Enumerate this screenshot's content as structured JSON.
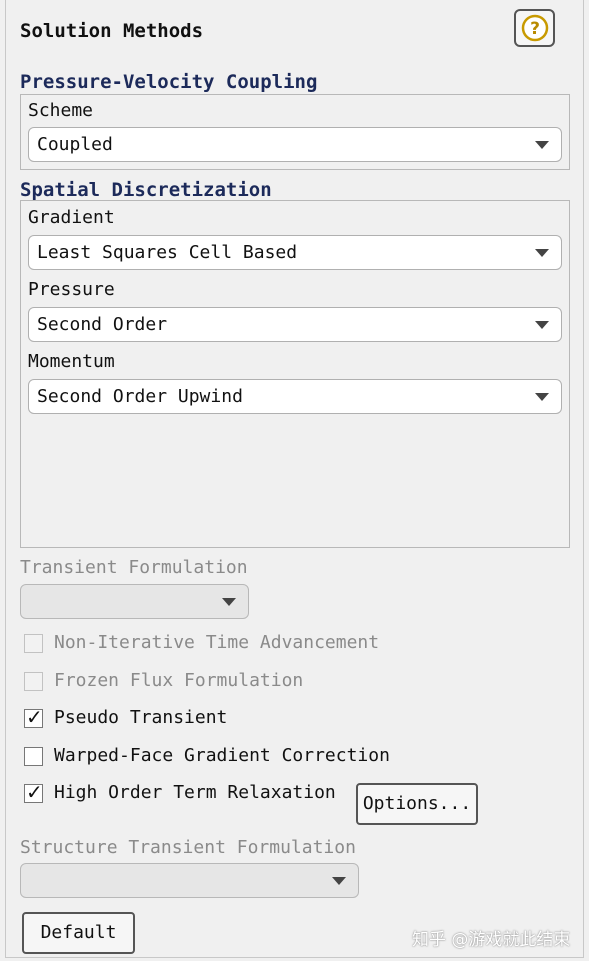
{
  "panel": {
    "title": "Solution Methods"
  },
  "help": {
    "icon": "help-icon",
    "glyph": "?"
  },
  "pressure_velocity": {
    "title": "Pressure-Velocity Coupling",
    "scheme_label": "Scheme",
    "scheme_value": "Coupled"
  },
  "spatial": {
    "title": "Spatial Discretization",
    "gradient_label": "Gradient",
    "gradient_value": "Least Squares Cell Based",
    "pressure_label": "Pressure",
    "pressure_value": "Second Order",
    "momentum_label": "Momentum",
    "momentum_value": "Second Order Upwind"
  },
  "transient": {
    "label": "Transient Formulation",
    "value": ""
  },
  "options": {
    "non_iterative": {
      "label": "Non-Iterative Time Advancement",
      "checked": false,
      "enabled": false
    },
    "frozen_flux": {
      "label": "Frozen Flux Formulation",
      "checked": false,
      "enabled": false
    },
    "pseudo_transient": {
      "label": "Pseudo Transient",
      "checked": true,
      "enabled": true
    },
    "warped_face": {
      "label": "Warped-Face Gradient Correction",
      "checked": false,
      "enabled": true
    },
    "high_order": {
      "label": "High Order Term Relaxation",
      "checked": true,
      "enabled": true
    },
    "options_button": "Options...",
    "check_glyph": "✓"
  },
  "structure_transient": {
    "label": "Structure Transient Formulation",
    "value": ""
  },
  "default_button": "Default",
  "watermark": "知乎 @游戏就此结束"
}
